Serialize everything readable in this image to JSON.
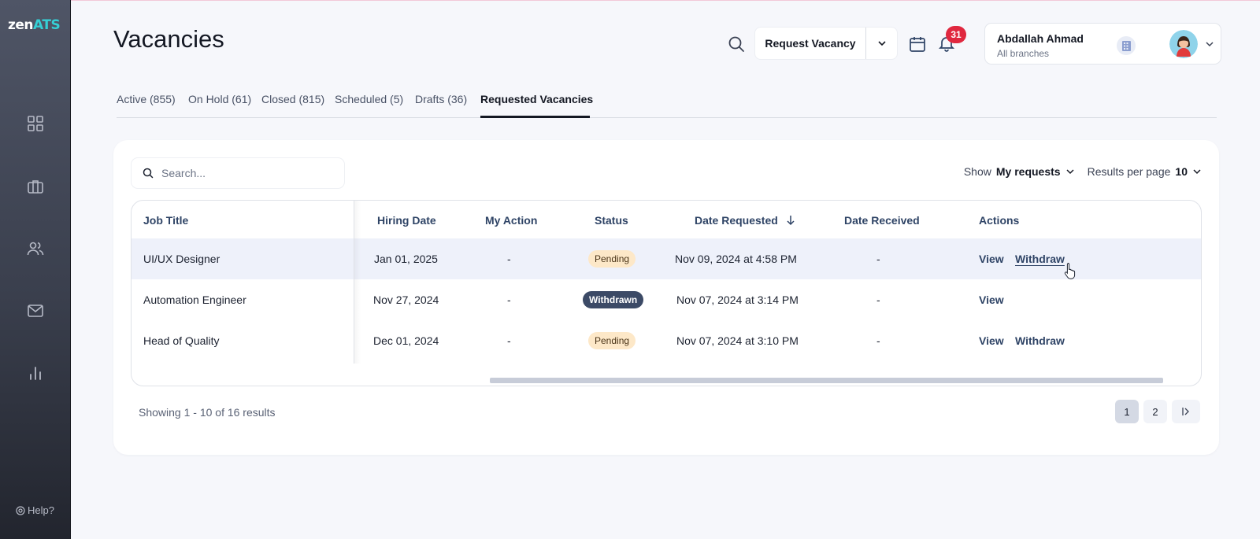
{
  "app": {
    "logo_main": "zen",
    "logo_accent": "ATS",
    "help_label": "Help?"
  },
  "header": {
    "title": "Vacancies",
    "request_vacancy_label": "Request Vacancy",
    "notification_count": "31",
    "user": {
      "name": "Abdallah Ahmad",
      "subtitle": "All branches"
    }
  },
  "tabs": [
    {
      "label": "Active (855)",
      "active": false
    },
    {
      "label": "On Hold (61)",
      "active": false
    },
    {
      "label": "Closed (815)",
      "active": false
    },
    {
      "label": "Scheduled (5)",
      "active": false
    },
    {
      "label": "Drafts (36)",
      "active": false
    },
    {
      "label": "Requested Vacancies",
      "active": true
    }
  ],
  "toolbar": {
    "search_placeholder": "Search...",
    "show_label": "Show",
    "show_value": "My requests",
    "results_label": "Results per page",
    "results_value": "10"
  },
  "table": {
    "columns": [
      "Job Title",
      "Hiring Date",
      "My Action",
      "Status",
      "Date Requested",
      "Date Received",
      "Actions"
    ],
    "rows": [
      {
        "job_title": "UI/UX Designer",
        "hiring_date": "Jan 01, 2025",
        "my_action": "-",
        "status": "Pending",
        "date_requested": "Nov 09, 2024 at 4:58 PM",
        "date_received": "-",
        "view": "View",
        "withdraw": "Withdraw"
      },
      {
        "job_title": "Automation Engineer",
        "hiring_date": "Nov 27, 2024",
        "my_action": "-",
        "status": "Withdrawn",
        "date_requested": "Nov 07, 2024 at 3:14 PM",
        "date_received": "-",
        "view": "View",
        "withdraw": ""
      },
      {
        "job_title": "Head of Quality",
        "hiring_date": "Dec 01, 2024",
        "my_action": "-",
        "status": "Pending",
        "date_requested": "Nov 07, 2024 at 3:10 PM",
        "date_received": "-",
        "view": "View",
        "withdraw": "Withdraw"
      }
    ]
  },
  "footer": {
    "showing_text": "Showing 1 - 10 of 16 results",
    "pages": [
      "1",
      "2"
    ]
  },
  "colors": {
    "accent": "#35d0d6",
    "badge": "#e0283f",
    "pending_bg": "#fde8c8",
    "withdrawn_bg": "#3c4a66",
    "link": "#2f4466"
  }
}
